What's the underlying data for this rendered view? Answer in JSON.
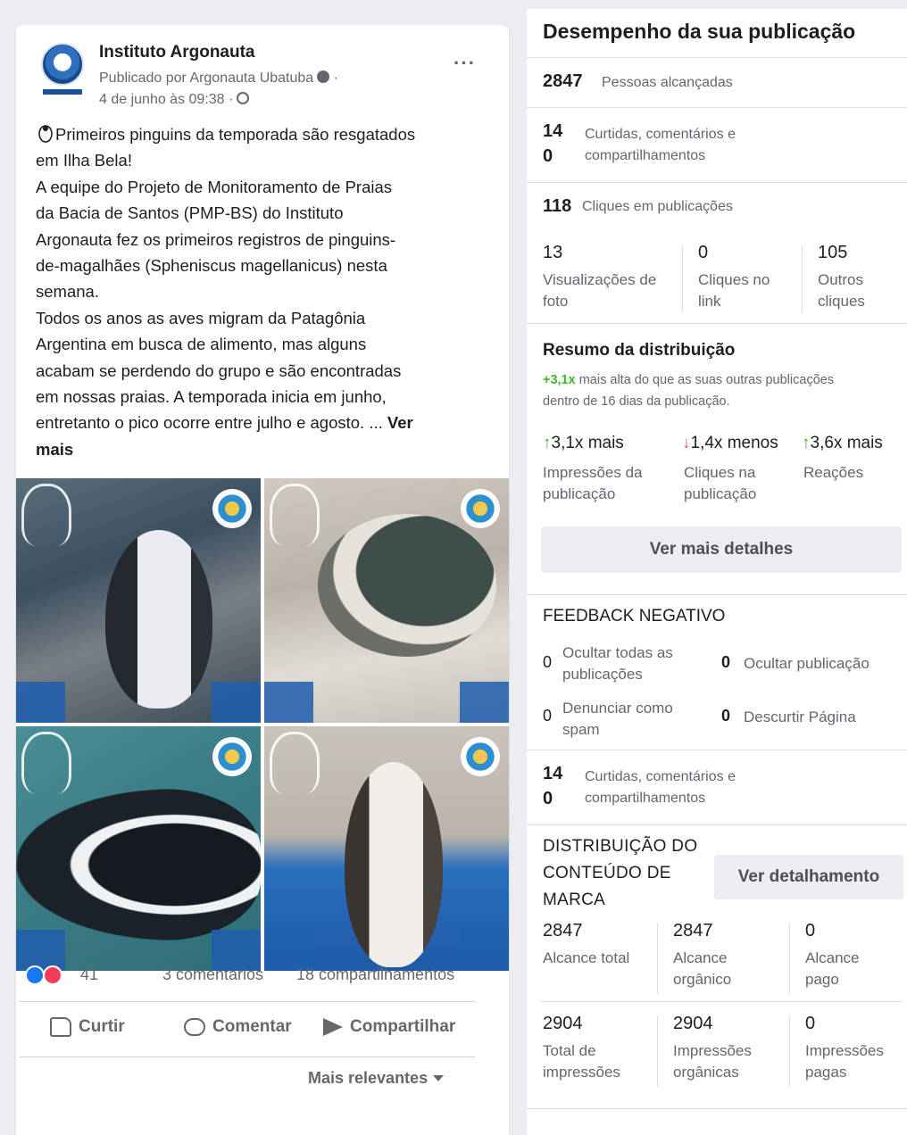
{
  "post": {
    "page_name": "Instituto Argonauta",
    "published_by": "Publicado por Argonauta Ubatuba",
    "date": "4 de junho às 09:38 ·",
    "more": "···",
    "text_lines": [
      "Primeiros pinguins da temporada são resgatados",
      "em Ilha Bela!",
      "A equipe do Projeto de Monitoramento de Praias",
      "da Bacia de Santos (PMP-BS) do Instituto",
      "Argonauta fez os primeiros registros de pinguins-",
      "de-magalhães (Spheniscus magellanicus) nesta",
      "semana.",
      "Todos os anos as aves migram da Patagônia",
      "Argentina em busca de alimento, mas alguns",
      "acabam se perdendo do grupo e são encontradas",
      "em nossas praias. A temporada inicia em junho,",
      "entretanto o pico ocorre entre julho e agosto. ..."
    ],
    "see_more_1": "Ver",
    "see_more_2": "mais",
    "reaction_count": "41",
    "comments": "3 comentários",
    "shares": "18 compartilhamentos",
    "actions": {
      "like": "Curtir",
      "comment": "Comentar",
      "share": "Compartilhar"
    },
    "sort": "Mais relevantes"
  },
  "panel": {
    "title": "Desempenho da sua publicação",
    "reach": {
      "value": "2847",
      "label": "Pessoas alcançadas"
    },
    "engagement": {
      "value_a": "14",
      "value_b": "0",
      "label_a": "Curtidas, comentários e",
      "label_b": "compartilhamentos"
    },
    "clicks": {
      "value": "118",
      "label": "Cliques em publicações"
    },
    "click_breakdown": [
      {
        "value": "13",
        "label_a": "Visualizações de",
        "label_b": "foto"
      },
      {
        "value": "0",
        "label_a": "Cliques no",
        "label_b": "link"
      },
      {
        "value": "105",
        "label_a": "Outros",
        "label_b": "cliques"
      }
    ],
    "distribution": {
      "title": "Resumo da distribuição",
      "highlight": "+3,1x",
      "text_a": " mais alta do que as suas outras publicações",
      "text_b": "dentro de 16 dias da publicação.",
      "metrics": [
        {
          "arrow": "↑",
          "value": "3,1x mais",
          "label_a": "Impressões da",
          "label_b": "publicação",
          "direction": "up"
        },
        {
          "arrow": "↓",
          "value": "1,4x menos",
          "label_a": "Cliques na",
          "label_b": "publicação",
          "direction": "down"
        },
        {
          "arrow": "↑",
          "value": "3,6x mais",
          "label_a": "Reações",
          "label_b": "",
          "direction": "up"
        }
      ],
      "button": "Ver mais detalhes"
    },
    "negative": {
      "title": "FEEDBACK NEGATIVO",
      "items": [
        {
          "value": "0",
          "label_a": "Ocultar todas as",
          "label_b": "publicações"
        },
        {
          "value": "0",
          "label_a": "Ocultar publicação",
          "label_b": ""
        },
        {
          "value": "0",
          "label_a": "Denunciar como",
          "label_b": "spam"
        },
        {
          "value": "0",
          "label_a": "Descurtir Página",
          "label_b": ""
        }
      ]
    },
    "engagement2": {
      "value_a": "14",
      "value_b": "0",
      "label_a": "Curtidas, comentários e",
      "label_b": "compartilhamentos"
    },
    "branded": {
      "title_a": "DISTRIBUIÇÃO DO",
      "title_b": "CONTEÚDO DE",
      "title_c": "MARCA",
      "button": "Ver detalhamento",
      "reach": [
        {
          "value": "2847",
          "label_a": "Alcance total",
          "label_b": ""
        },
        {
          "value": "2847",
          "label_a": "Alcance",
          "label_b": "orgânico"
        },
        {
          "value": "0",
          "label_a": "Alcance",
          "label_b": "pago"
        }
      ],
      "impressions": [
        {
          "value": "2904",
          "label_a": "Total de",
          "label_b": "impressões"
        },
        {
          "value": "2904",
          "label_a": "Impressões",
          "label_b": "orgânicas"
        },
        {
          "value": "0",
          "label_a": "Impressões",
          "label_b": "pagas"
        }
      ]
    }
  },
  "colors": {
    "accent_green": "#42b72a",
    "down_red": "#e0545f",
    "like_blue": "#1877f2",
    "love_red": "#f33e58"
  }
}
